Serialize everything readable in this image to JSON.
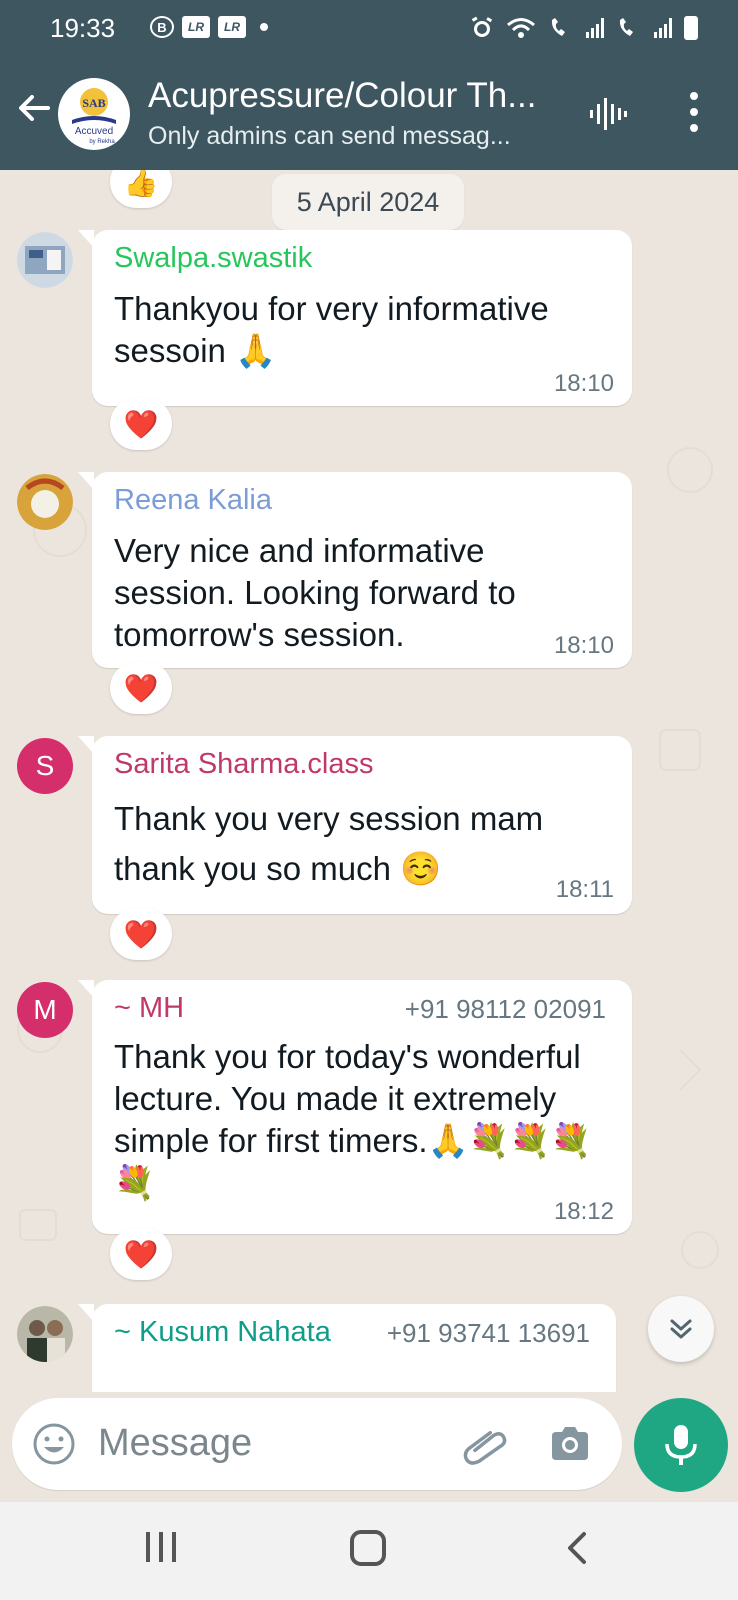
{
  "status_bar": {
    "time": "19:33",
    "badges": [
      "B",
      "LR",
      "LR"
    ]
  },
  "header": {
    "title": "Acupressure/Colour Th...",
    "subtitle": "Only admins can send messag...",
    "logo_text": "Accuved",
    "logo_subtext": "by Rekha",
    "logo_mark": "SAB"
  },
  "chat": {
    "date_chip": "5 April 2024",
    "messages": [
      {
        "sender": "Swalpa.swastik",
        "sender_color": "#25c65a",
        "phone": "",
        "text": "Thankyou  for very informative sessoin 🙏",
        "time": "18:10",
        "reaction": "❤️",
        "avatar_letter": "",
        "avatar_color": "#9fb3c8"
      },
      {
        "sender": "Reena Kalia",
        "sender_color": "#7b9cd6",
        "phone": "",
        "text": "Very nice and informative session. Looking forward to tomorrow's session.",
        "time": "18:10",
        "reaction": "❤️",
        "avatar_letter": "",
        "avatar_color": "#c8953a"
      },
      {
        "sender": "Sarita Sharma.class",
        "sender_color": "#c0396b",
        "phone": "",
        "text": "Thank you very  session mam thank you so much ☺️",
        "time": "18:11",
        "reaction": "❤️",
        "avatar_letter": "S",
        "avatar_color": "#d42f6a"
      },
      {
        "sender": "~ MH",
        "sender_color": "#c0396b",
        "phone": "+91 98112 02091",
        "text": "Thank you for today's wonderful lecture. You made it extremely simple for first timers.🙏💐💐💐💐",
        "time": "18:12",
        "reaction": "❤️",
        "avatar_letter": "M",
        "avatar_color": "#d42f6a"
      },
      {
        "sender": "~ Kusum Nahata",
        "sender_color": "#0f9d8a",
        "phone": "+91 93741 13691",
        "text": "",
        "time": "",
        "reaction": "",
        "avatar_letter": "",
        "avatar_color": "#8a9a7a"
      }
    ],
    "top_reaction": "👍"
  },
  "composer": {
    "placeholder": "Message"
  },
  "colors": {
    "header_bg": "#3d5660",
    "chat_bg": "#ece5dd",
    "accent_green": "#1fa784"
  },
  "icons": [
    "back-arrow-icon",
    "waveform-icon",
    "more-vert-icon",
    "emoji-icon",
    "attach-icon",
    "camera-icon",
    "mic-icon",
    "chevron-double-down-icon",
    "thumbs-up-icon",
    "heart-icon"
  ]
}
